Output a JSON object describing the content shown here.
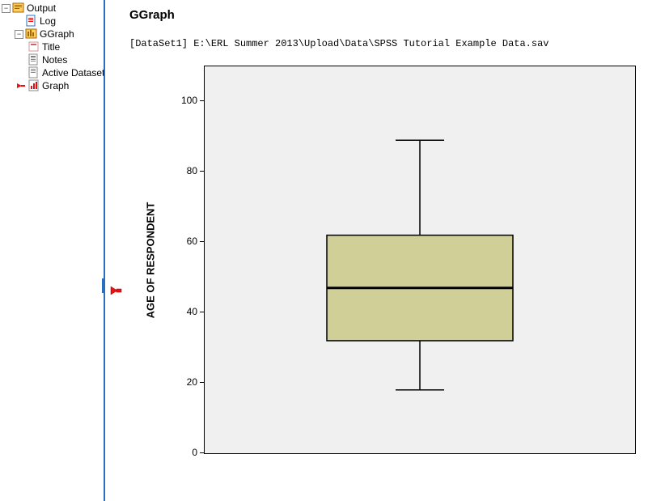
{
  "tree": {
    "root_label": "Output",
    "log_label": "Log",
    "ggraph_label": "GGraph",
    "title_label": "Title",
    "notes_label": "Notes",
    "active_label": "Active Dataset",
    "graph_label": "Graph"
  },
  "content": {
    "section_title": "GGraph",
    "dataset_line": "[DataSet1] E:\\ERL Summer 2013\\Upload\\Data\\SPSS Tutorial Example Data.sav"
  },
  "chart_data": {
    "type": "boxplot",
    "ylabel": "AGE OF RESPONDENT",
    "xlabel": "",
    "ylim": [
      0,
      110
    ],
    "yticks": [
      0,
      20,
      40,
      60,
      80,
      100
    ],
    "series": [
      {
        "name": "AGE OF RESPONDENT",
        "min": 18,
        "q1": 32,
        "median": 47,
        "q3": 62,
        "max": 89
      }
    ],
    "box_fill": "#d1cf98",
    "box_stroke": "#000000",
    "panel_bg": "#f0f0f0"
  }
}
